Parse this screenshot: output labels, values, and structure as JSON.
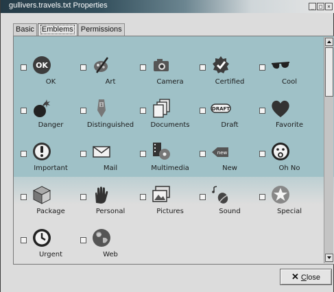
{
  "window": {
    "title": "gullivers.travels.txt Properties",
    "controls": {
      "minimize": "_",
      "maximize": "□",
      "close": "×"
    }
  },
  "tabs": [
    {
      "label": "Basic",
      "active": false
    },
    {
      "label": "Emblems",
      "active": true
    },
    {
      "label": "Permissions",
      "active": false
    }
  ],
  "emblems": [
    {
      "label": "OK",
      "icon": "ok-icon"
    },
    {
      "label": "Art",
      "icon": "art-palette-icon"
    },
    {
      "label": "Camera",
      "icon": "camera-icon"
    },
    {
      "label": "Certified",
      "icon": "certified-seal-icon"
    },
    {
      "label": "Cool",
      "icon": "sunglasses-icon"
    },
    {
      "label": "Danger",
      "icon": "bomb-icon"
    },
    {
      "label": "Distinguished",
      "icon": "ribbon-medal-icon"
    },
    {
      "label": "Documents",
      "icon": "documents-icon"
    },
    {
      "label": "Draft",
      "icon": "draft-stamp-icon"
    },
    {
      "label": "Favorite",
      "icon": "heart-icon"
    },
    {
      "label": "Important",
      "icon": "exclamation-icon"
    },
    {
      "label": "Mail",
      "icon": "envelope-icon"
    },
    {
      "label": "Multimedia",
      "icon": "film-reel-icon"
    },
    {
      "label": "New",
      "icon": "new-badge-icon"
    },
    {
      "label": "Oh No",
      "icon": "sad-face-icon"
    },
    {
      "label": "Package",
      "icon": "package-box-icon"
    },
    {
      "label": "Personal",
      "icon": "hand-icon"
    },
    {
      "label": "Pictures",
      "icon": "pictures-icon"
    },
    {
      "label": "Sound",
      "icon": "sound-note-icon"
    },
    {
      "label": "Special",
      "icon": "star-icon"
    },
    {
      "label": "Urgent",
      "icon": "clock-icon"
    },
    {
      "label": "Web",
      "icon": "globe-icon"
    }
  ],
  "close_button": {
    "label_first": "C",
    "label_rest": "lose",
    "icon": "close-x-icon"
  },
  "colors": {
    "panel_band": "#9fc1c7",
    "title_dark": "#243a46"
  }
}
